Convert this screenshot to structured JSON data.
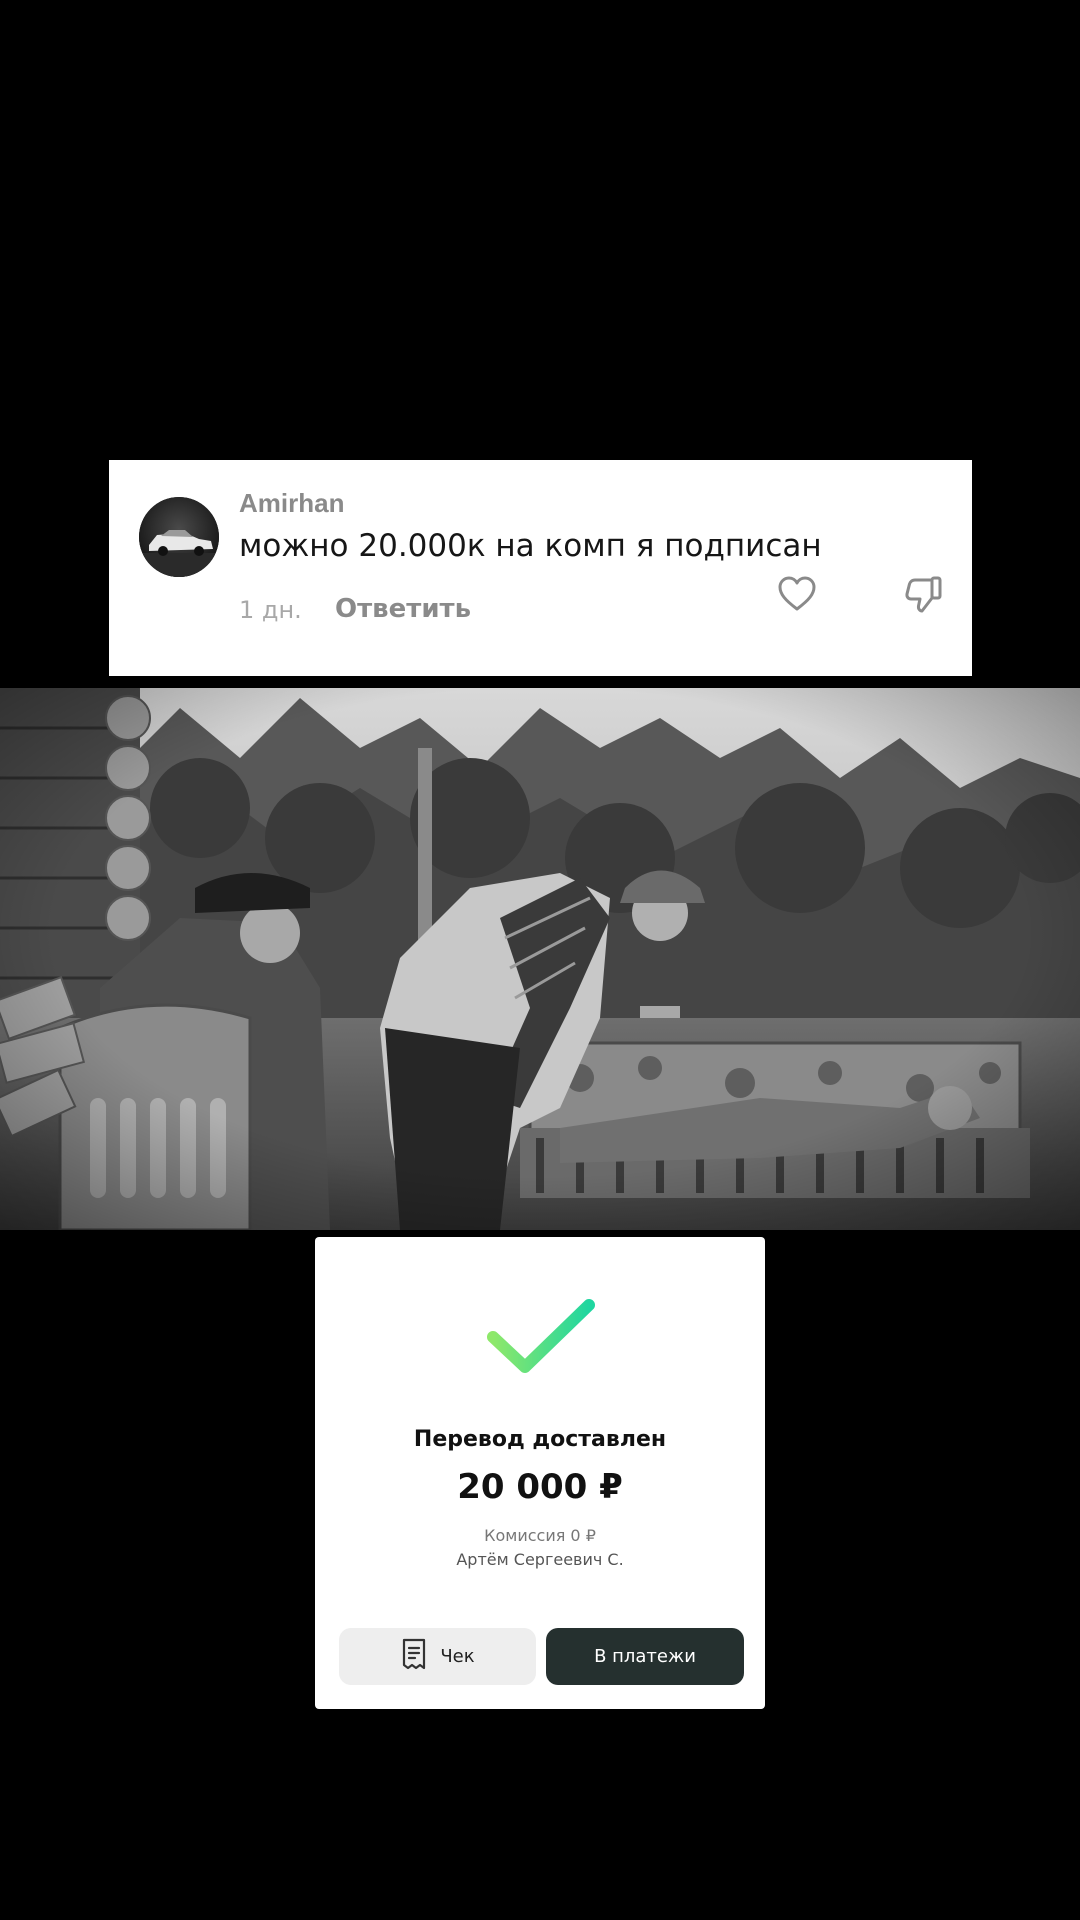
{
  "comment": {
    "author": "Amirhan",
    "text": "можно 20.000к на комп я подписан",
    "time": "1 дн.",
    "reply_label": "Ответить",
    "avatar_icon": "car-photo-avatar",
    "like_icon": "heart-outline-icon",
    "dislike_icon": "thumbs-down-outline-icon"
  },
  "photo": {
    "style": "grayscale",
    "icon": "porch-scene-photo"
  },
  "transfer": {
    "status": "Перевод доставлен",
    "amount": "20 000 ₽",
    "commission": "Комиссия 0 ₽",
    "recipient": "Артём Сергеевич С.",
    "receipt_label": "Чек",
    "payments_label": "В платежи",
    "check_icon": "checkmark-icon",
    "receipt_icon": "receipt-icon",
    "colors": {
      "check_start": "#8ee86a",
      "check_end": "#1fd6a0",
      "dark_button": "#25302f",
      "light_button": "#eeeeee"
    }
  }
}
